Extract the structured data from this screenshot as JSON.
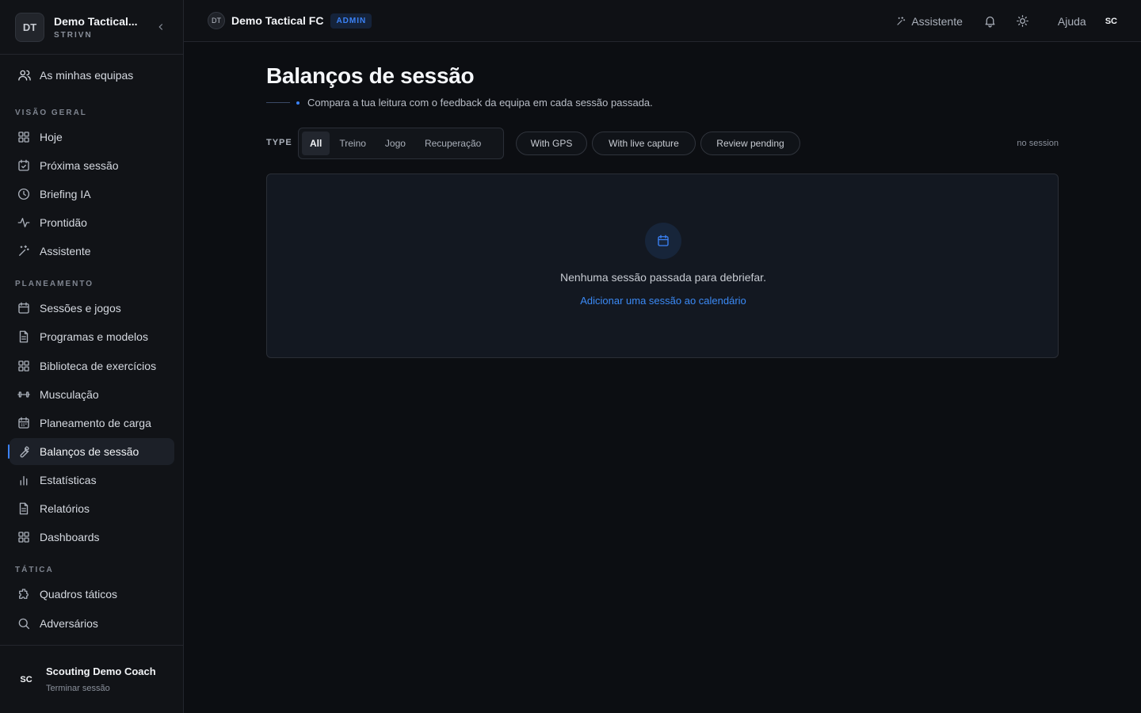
{
  "sidebar": {
    "brand_initials": "DT",
    "brand_name": "Demo Tactical...",
    "brand_sub": "STRIVN",
    "teams_link": "As minhas equipas",
    "sections": {
      "overview": "VISÃO GERAL",
      "planning": "PLANEAMENTO",
      "tactics": "TÁTICA"
    },
    "items": {
      "today": "Hoje",
      "next_session": "Próxima sessão",
      "ai_briefing": "Briefing IA",
      "readiness": "Prontidão",
      "assistant": "Assistente",
      "sessions_games": "Sessões e jogos",
      "programs": "Programas e modelos",
      "exercise_library": "Biblioteca de exercícios",
      "strength": "Musculação",
      "load_planning": "Planeamento de carga",
      "session_debriefs": "Balanços de sessão",
      "statistics": "Estatísticas",
      "reports": "Relatórios",
      "dashboards": "Dashboards",
      "tactic_boards": "Quadros táticos",
      "opponents": "Adversários"
    },
    "user": {
      "initials": "SC",
      "name": "Scouting Demo Coach",
      "logout": "Terminar sessão"
    }
  },
  "header": {
    "team_initials": "DT",
    "team_name": "Demo Tactical FC",
    "role_badge": "ADMIN",
    "assistant": "Assistente",
    "help": "Ajuda",
    "user_initials": "SC"
  },
  "main": {
    "title": "Balanços de sessão",
    "subtitle": "Compara a tua leitura com o feedback da equipa em cada sessão passada.",
    "filters": {
      "type_label": "TYPE",
      "segments": {
        "all": "All",
        "training": "Treino",
        "game": "Jogo",
        "recovery": "Recuperação"
      },
      "with_gps": "With GPS",
      "with_live_capture": "With live capture",
      "review_pending": "Review pending",
      "status": "no session"
    },
    "empty": {
      "message": "Nenhuma sessão passada para debriefar.",
      "action": "Adicionar uma sessão ao calendário"
    }
  },
  "colors": {
    "accent": "#3b82f6",
    "background": "#0c0e12",
    "sidebar": "#111317"
  }
}
